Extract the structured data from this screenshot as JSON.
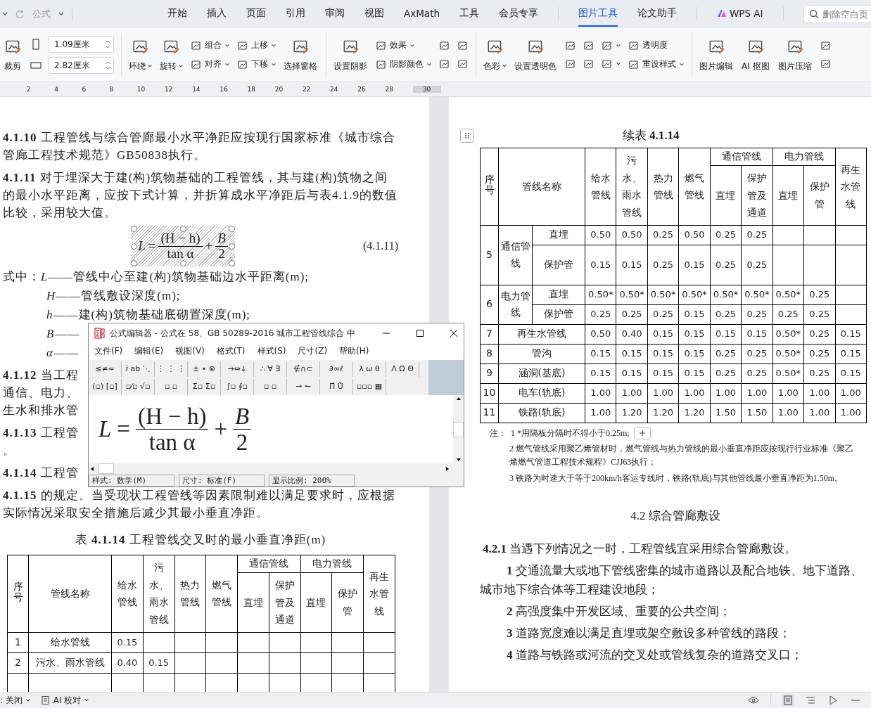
{
  "quick_access": {
    "title": "公式"
  },
  "tabs": [
    {
      "label": "开始",
      "selected": false
    },
    {
      "label": "插入",
      "selected": false
    },
    {
      "label": "页面",
      "selected": false
    },
    {
      "label": "引用",
      "selected": false
    },
    {
      "label": "审阅",
      "selected": false
    },
    {
      "label": "视图",
      "selected": false
    },
    {
      "label": "AxMath",
      "selected": false
    },
    {
      "label": "工具",
      "selected": false
    },
    {
      "label": "会员专享",
      "selected": false
    },
    {
      "label": "图片工具",
      "selected": true
    },
    {
      "label": "论文助手",
      "selected": false
    }
  ],
  "ai_button": {
    "label": "WPS AI"
  },
  "search": {
    "placeholder": "删除空白页"
  },
  "ribbon": [
    {
      "kind": "large",
      "label": "裁剪",
      "dropdown": false
    },
    {
      "kind": "fields",
      "fields": [
        {
          "value": "1.09厘米"
        },
        {
          "value": "2.82厘米"
        }
      ]
    },
    {
      "kind": "divider"
    },
    {
      "kind": "large",
      "label": "环绕",
      "dropdown": true
    },
    {
      "kind": "large",
      "label": "旋转",
      "dropdown": true
    },
    {
      "kind": "stack",
      "items": [
        {
          "label": "组合",
          "dropdown": true
        },
        {
          "label": "对齐",
          "dropdown": true
        }
      ]
    },
    {
      "kind": "stack",
      "items": [
        {
          "label": "上移",
          "dropdown": true
        },
        {
          "label": "下移",
          "dropdown": true
        }
      ]
    },
    {
      "kind": "large",
      "label": "选择窗格",
      "dropdown": false
    },
    {
      "kind": "divider"
    },
    {
      "kind": "large",
      "label": "设置阴影",
      "dropdown": false
    },
    {
      "kind": "stack",
      "items": [
        {
          "label": "效果",
          "dropdown": true
        },
        {
          "label": "阴影颜色",
          "dropdown": true
        }
      ]
    },
    {
      "kind": "stack",
      "items": [
        {
          "dropdown": false
        },
        {
          "dropdown": false
        }
      ]
    },
    {
      "kind": "stack",
      "items": [
        {
          "dropdown": false
        },
        {
          "dropdown": false
        }
      ]
    },
    {
      "kind": "divider"
    },
    {
      "kind": "large",
      "label": "色彩",
      "dropdown": true
    },
    {
      "kind": "large",
      "label": "设置透明色",
      "dropdown": false
    },
    {
      "kind": "stack",
      "items": [
        {
          "dropdown": false
        },
        {
          "dropdown": false
        }
      ]
    },
    {
      "kind": "stack",
      "items": [
        {
          "dropdown": false
        },
        {
          "dropdown": false
        }
      ]
    },
    {
      "kind": "stack",
      "items": [
        {
          "dropdown": true
        },
        {
          "dropdown": true
        }
      ]
    },
    {
      "kind": "stack",
      "items": [
        {
          "label": "透明度",
          "dropdown": false
        },
        {
          "label": "重设样式",
          "dropdown": true
        }
      ]
    },
    {
      "kind": "divider"
    },
    {
      "kind": "large",
      "label": "图片编辑",
      "dropdown": false
    },
    {
      "kind": "large",
      "label": "AI 抠图",
      "dropdown": false
    },
    {
      "kind": "large",
      "label": "图片压缩",
      "dropdown": false
    },
    {
      "kind": "stack",
      "items": [
        {
          "dropdown": false
        },
        {
          "dropdown": false
        }
      ]
    }
  ],
  "ruler": [
    "2",
    "4",
    "6",
    "8",
    "10",
    "12",
    "14",
    "16",
    "18",
    "20",
    "22",
    "24",
    "26",
    "28",
    "30"
  ],
  "left_page": {
    "blocks": [
      {
        "kind": "para",
        "num": "4.1.10",
        "text": "工程管线与综合管廊最小水平净距应按现行国家标准《城市综合管廊工程技术规范》GB50838执行。"
      },
      {
        "kind": "para",
        "num": "4.1.11",
        "text": "对于埋深大于建(构)筑物基础的工程管线，其与建(构)筑物之间的最小水平距离，应按下式计算，并折算成水平净距后与表4.1.9的数值比较，采用较大值。"
      },
      {
        "kind": "formula",
        "lhs": "L",
        "eq": "=",
        "num": "(H − h)",
        "den": "tan α",
        "plus": "+",
        "num2": "B",
        "den2": "2",
        "tag": "(4.1.11)"
      },
      {
        "kind": "where",
        "lead": "式中：",
        "sym": "L",
        "text": "——管线中心至建(构)筑物基础边水平距离(m);"
      },
      {
        "kind": "where",
        "sym": "H",
        "text": "——管线敷设深度(m);"
      },
      {
        "kind": "where",
        "sym": "h",
        "text": "——建(构)筑物基础底砌置深度(m);"
      },
      {
        "kind": "where",
        "sym": "B",
        "text": "——"
      },
      {
        "kind": "where",
        "sym": "α",
        "text": "——"
      },
      {
        "kind": "para",
        "num": "4.1.12",
        "text": "当工程"
      },
      {
        "kind": "line",
        "text": "通信、电力、"
      },
      {
        "kind": "line",
        "text": "生水和排水管"
      },
      {
        "kind": "para",
        "num": "4.1.13",
        "text": "工程管"
      },
      {
        "kind": "line",
        "text": "。"
      },
      {
        "kind": "para",
        "num": "4.1.14",
        "text": "工程管"
      },
      {
        "kind": "para",
        "num": "4.1.15",
        "text": "的规定。当受现状工程管线等因素限制难以满足要求时，应根据实际情况采取安全措施后减少其最小垂直净距。"
      },
      {
        "kind": "caption",
        "text": "表 **4.1.14**  工程管线交叉时的最小垂直净距(m)"
      }
    ],
    "table": {
      "header": {
        "no": "序号",
        "name": "管线名称",
        "cols": [
          {
            "label": "给水管线"
          },
          {
            "label": "污水、雨水管线"
          },
          {
            "label": "热力管线"
          },
          {
            "label": "燃气管线"
          },
          {
            "group": "通信管线",
            "subs": [
              "直埋",
              "保护管及通道"
            ]
          },
          {
            "group": "电力管线",
            "subs": [
              "直埋",
              "保护管"
            ]
          },
          {
            "label": "再生水管线"
          }
        ]
      },
      "rows": [
        {
          "no": "1",
          "name": "给水管线",
          "values": [
            "0.15"
          ]
        },
        {
          "no": "2",
          "name": "污水、雨水管线",
          "values": [
            "0.40",
            "0.15"
          ]
        }
      ]
    }
  },
  "right_page": {
    "title": "续表 **4.1.14**",
    "table": {
      "header": {
        "no": "序号",
        "name": "管线名称",
        "cols": [
          {
            "label": "给水管线"
          },
          {
            "label": "污水、雨水管线"
          },
          {
            "label": "热力管线"
          },
          {
            "label": "燃气管线"
          },
          {
            "group": "通信管线",
            "subs": [
              "直埋",
              "保护管及通道"
            ]
          },
          {
            "group": "电力管线",
            "subs": [
              "直埋",
              "保护管"
            ]
          },
          {
            "label": "再生水管线"
          }
        ]
      },
      "rows": [
        {
          "kind": "group",
          "no": "5",
          "name": "通信管线",
          "subs": [
            {
              "name": "直埋",
              "values": [
                "0.50",
                "0.50",
                "0.25",
                "0.50",
                "0.25",
                "0.25"
              ]
            },
            {
              "name": "保护管",
              "values": [
                "0.15",
                "0.15",
                "0.25",
                "0.15",
                "0.25",
                "0.25"
              ]
            }
          ]
        },
        {
          "kind": "group",
          "no": "6",
          "name": "电力管线",
          "subs": [
            {
              "name": "直埋",
              "values": [
                "0.50*",
                "0.50*",
                "0.50*",
                "0.50*",
                "0.50*",
                "0.50*",
                "0.50*",
                "0.25"
              ]
            },
            {
              "name": "保护管",
              "values": [
                "0.25",
                "0.25",
                "0.25",
                "0.15",
                "0.25",
                "0.25",
                "0.25",
                "0.25"
              ]
            }
          ]
        },
        {
          "kind": "single",
          "no": "7",
          "name": "再生水管线",
          "values": [
            "0.50",
            "0.40",
            "0.15",
            "0.15",
            "0.15",
            "0.15",
            "0.50*",
            "0.25",
            "0.15"
          ]
        },
        {
          "kind": "single",
          "no": "8",
          "name": "管沟",
          "values": [
            "0.15",
            "0.15",
            "0.15",
            "0.15",
            "0.25",
            "0.25",
            "0.50*",
            "0.25",
            "0.15"
          ]
        },
        {
          "kind": "single",
          "no": "9",
          "name": "涵洞(基底)",
          "values": [
            "0.15",
            "0.15",
            "0.15",
            "0.15",
            "0.25",
            "0.25",
            "0.50*",
            "0.25",
            "0.15"
          ]
        },
        {
          "kind": "single",
          "no": "10",
          "name": "电车(轨底)",
          "values": [
            "1.00",
            "1.00",
            "1.00",
            "1.00",
            "1.00",
            "1.00",
            "1.00",
            "1.00",
            "1.00"
          ]
        },
        {
          "kind": "single",
          "no": "11",
          "name": "铁路(轨底)",
          "values": [
            "1.00",
            "1.20",
            "1.20",
            "1.20",
            "1.50",
            "1.50",
            "1.00",
            "1.00",
            "1.00"
          ]
        }
      ]
    },
    "notes_lead": "注：",
    "notes": [
      "1 *用隔板分隔时不得小于0.25m;",
      "2 燃气管线采用聚乙烯管材时，燃气管线与热力管线的最小垂直净距应按现行行业标准《聚乙烯燃气管道工程技术规程》CJJ63执行；",
      "3 铁路为时速大于等于200km/h客运专线时，铁路(轨底)与其他管线最小垂直净距为1.50m。"
    ],
    "section": "4.2 综合管廊敷设",
    "clause": {
      "num": "4.2.1",
      "text": "当遇下列情况之一时，工程管线宜采用综合管廊敷设。"
    },
    "items": [
      {
        "num": "1",
        "text": "交通流量大或地下管线密集的城市道路以及配合地铁、地下道路、城市地下综合体等工程建设地段；"
      },
      {
        "num": "2",
        "text": "高强度集中开发区域、重要的公共空间；"
      },
      {
        "num": "3",
        "text": "道路宽度难以满足直埋或架空敷设多种管线的路段；"
      },
      {
        "num": "4",
        "text": "道路与铁路或河流的交叉处或管线复杂的道路交叉口；"
      }
    ]
  },
  "equation_editor": {
    "title": "公式编辑器 - 公式在 58、GB 50289-2016 城市工程管线综合 中",
    "menu": [
      "文件(F)",
      "编辑(E)",
      "视图(V)",
      "格式(T)",
      "样式(S)",
      "尺寸(Z)",
      "帮助(H)"
    ],
    "palette_rows": [
      [
        "≤≠≈",
        "ⅈ ab ⋱",
        "⋮ ⋮ ⋮",
        "± • ⊗",
        "→⇔↓",
        "∴ ∀ ∃",
        "∉∩⊂",
        "∂∞ℓ",
        "λ ω θ",
        "Λ Ω Θ"
      ],
      [
        "(▫) [▫]",
        "▫⁄▫ √▫",
        "▫ ▫",
        "Σ▫ Σ▫",
        "∫▫ ∮▫",
        "▫ ▫",
        "⇀ ↼",
        "Π̂ Ů",
        "▫▫▫ ▦"
      ]
    ],
    "formula": {
      "lhs": "L",
      "eq": "=",
      "num": "(H − h)",
      "den": "tan α",
      "plus": "+",
      "num2": "B",
      "den2": "2"
    },
    "status": [
      "样式: 数学(M)",
      "尺寸: 标准(F)",
      "显示比例: 200%"
    ]
  },
  "status_bar": {
    "left": [
      {
        "label": ": 关闭",
        "dropdown": true
      },
      {
        "label": "AI 校对",
        "dropdown": true
      }
    ]
  }
}
